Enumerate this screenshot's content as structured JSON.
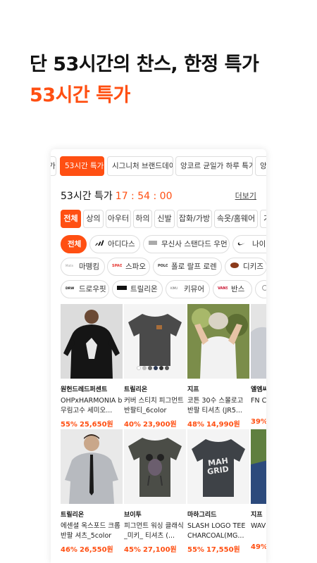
{
  "hero": {
    "title": "단 53시간의 찬스, 한정 특가",
    "subtitle": "53시간 특가"
  },
  "tabs": [
    {
      "label": "가"
    },
    {
      "label": "53시간 특가"
    },
    {
      "label": "시그니처 브랜드데이"
    },
    {
      "label": "앙코르 균일가 하루 특가"
    },
    {
      "label": "앙"
    }
  ],
  "section": {
    "title": "53시간 특가",
    "timer": "17 : 54 : 00",
    "more": "더보기"
  },
  "categories": [
    {
      "label": "전체"
    },
    {
      "label": "상의"
    },
    {
      "label": "아우터"
    },
    {
      "label": "하의"
    },
    {
      "label": "신발"
    },
    {
      "label": "잡화/가방"
    },
    {
      "label": "속옷/홈웨어"
    },
    {
      "label": "기"
    }
  ],
  "brands": [
    {
      "label": "전체",
      "logo": ""
    },
    {
      "label": "아디다스",
      "logo": "adidas-logo"
    },
    {
      "label": "무신사 스탠다드 우먼",
      "logo": "musinsa-logo"
    },
    {
      "label": "나이키",
      "logo": "nike-logo"
    },
    {
      "label": "마뗑킴",
      "logo": "matin-kim-logo"
    },
    {
      "label": "스파오",
      "logo": "spao-logo"
    },
    {
      "label": "폴로 랄프 로렌",
      "logo": "polo-logo"
    },
    {
      "label": "디키즈",
      "logo": "dickies-logo"
    },
    {
      "label": "드로우핏",
      "logo": "drawfit-logo"
    },
    {
      "label": "트릴리온",
      "logo": "trillion-logo"
    },
    {
      "label": "키뮤어",
      "logo": "kimuore-logo"
    },
    {
      "label": "반스",
      "logo": "vans-logo"
    },
    {
      "label": "",
      "logo": "brand-logo"
    }
  ],
  "products": [
    {
      "brand": "원헌드레드퍼센트",
      "name": "OHPxHARMONIA b무림고수 세미오...",
      "discount": "55%",
      "price": "25,650원"
    },
    {
      "brand": "트릴리온",
      "name": "커버 스티치 피그먼트 반팔티_6color",
      "discount": "40%",
      "price": "23,900원"
    },
    {
      "brand": "지프",
      "name": "코튼 30수 스몰로고 반팔 티셔츠 (JR5...",
      "discount": "48%",
      "price": "14,990원"
    },
    {
      "brand": "엘엠씨",
      "name": "FN C TEE",
      "discount": "39%",
      "price": ""
    },
    {
      "brand": "트릴리온",
      "name": "에센셜 옥스포드 크롭 반팔 셔츠_5color",
      "discount": "46%",
      "price": "26,550원"
    },
    {
      "brand": "브이투",
      "name": "피그먼트 워싱 클래식 _미키_ 티셔츠 (...",
      "discount": "45%",
      "price": "27,100원"
    },
    {
      "brand": "마하그리드",
      "name": "SLASH LOGO TEE CHARCOAL(MG...",
      "discount": "55%",
      "price": "17,550원"
    },
    {
      "brand": "지프",
      "name": "WAV",
      "discount": "49%",
      "price": ""
    }
  ],
  "colors": {
    "accent": "#ff4f12"
  }
}
